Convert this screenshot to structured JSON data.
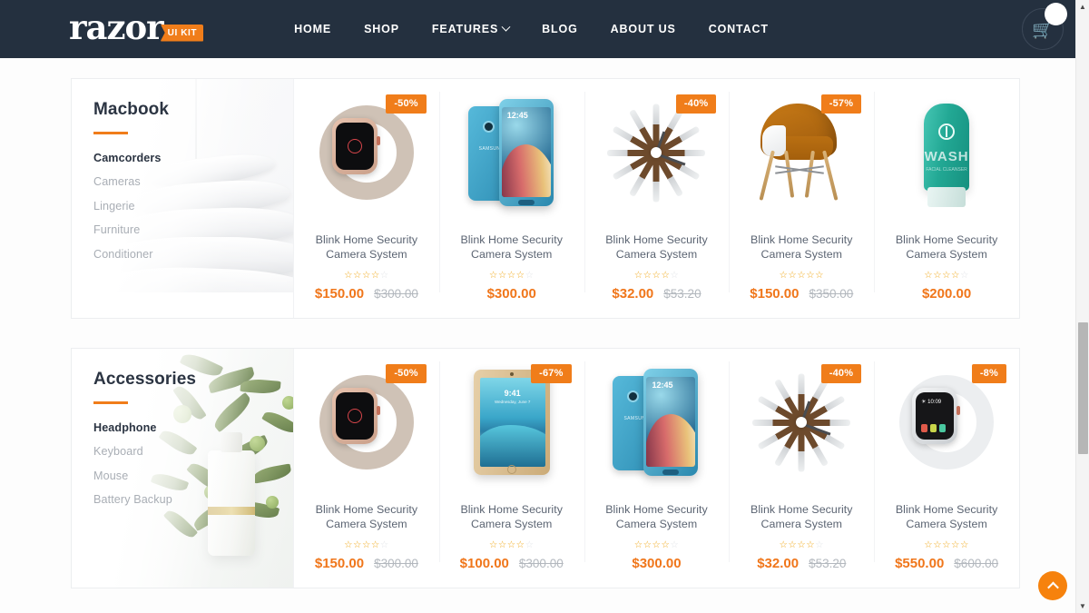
{
  "header": {
    "brand_word": "razor",
    "brand_badge": "UI KIT",
    "nav": [
      {
        "label": "HOME",
        "has_dropdown": false
      },
      {
        "label": "SHOP",
        "has_dropdown": false
      },
      {
        "label": "FEATURES",
        "has_dropdown": true
      },
      {
        "label": "BLOG",
        "has_dropdown": false
      },
      {
        "label": "ABOUT US",
        "has_dropdown": false
      },
      {
        "label": "CONTACT",
        "has_dropdown": false
      }
    ],
    "cart": {
      "icon": "shopping-basket-icon",
      "count": ""
    }
  },
  "colors": {
    "accent": "#f07d1a",
    "price": "#f0761a",
    "header_bg": "#24303f",
    "star": "#f0a81a",
    "old_price": "#b3b8be"
  },
  "sections": [
    {
      "title": "Macbook",
      "categories": [
        {
          "label": "Camcorders",
          "active": true
        },
        {
          "label": "Cameras",
          "active": false
        },
        {
          "label": "Lingerie",
          "active": false
        },
        {
          "label": "Furniture",
          "active": false
        },
        {
          "label": "Conditioner",
          "active": false
        }
      ],
      "products": [
        {
          "title": "Blink Home Security Camera System",
          "badge": "-50%",
          "price": "$150.00",
          "old_price": "$300.00",
          "rating": 4.5,
          "art": "watch-pink"
        },
        {
          "title": "Blink Home Security Camera System",
          "badge": "",
          "price": "$300.00",
          "old_price": "",
          "rating": 4.5,
          "art": "phone-blue"
        },
        {
          "title": "Blink Home Security Camera System",
          "badge": "-40%",
          "price": "$32.00",
          "old_price": "$53.20",
          "rating": 4.5,
          "art": "starburst-clock"
        },
        {
          "title": "Blink Home Security Camera System",
          "badge": "-57%",
          "price": "$150.00",
          "old_price": "$350.00",
          "rating": 5,
          "art": "eames-chair"
        },
        {
          "title": "Blink Home Security Camera System",
          "badge": "",
          "price": "$200.00",
          "old_price": "",
          "rating": 4.5,
          "art": "facewash-tube"
        }
      ]
    },
    {
      "title": "Accessories",
      "categories": [
        {
          "label": "Headphone",
          "active": true
        },
        {
          "label": "Keyboard",
          "active": false
        },
        {
          "label": "Mouse",
          "active": false
        },
        {
          "label": "Battery Backup",
          "active": false
        }
      ],
      "products": [
        {
          "title": "Blink Home Security Camera System",
          "badge": "-50%",
          "price": "$150.00",
          "old_price": "$300.00",
          "rating": 4.5,
          "art": "watch-pink"
        },
        {
          "title": "Blink Home Security Camera System",
          "badge": "-67%",
          "price": "$100.00",
          "old_price": "$300.00",
          "rating": 4.5,
          "art": "ipad-gold"
        },
        {
          "title": "Blink Home Security Camera System",
          "badge": "",
          "price": "$300.00",
          "old_price": "",
          "rating": 4.5,
          "art": "phone-blue"
        },
        {
          "title": "Blink Home Security Camera System",
          "badge": "-40%",
          "price": "$32.00",
          "old_price": "$53.20",
          "rating": 4.5,
          "art": "starburst-clock"
        },
        {
          "title": "Blink Home Security Camera System",
          "badge": "-8%",
          "price": "$550.00",
          "old_price": "$600.00",
          "rating": 5,
          "art": "watch-white"
        }
      ]
    }
  ],
  "scroll_top_button": {
    "icon": "chevron-up-icon",
    "label": ""
  },
  "scrollbar": {
    "up_icon": "caret-up-icon",
    "down_icon": "caret-down-icon"
  }
}
